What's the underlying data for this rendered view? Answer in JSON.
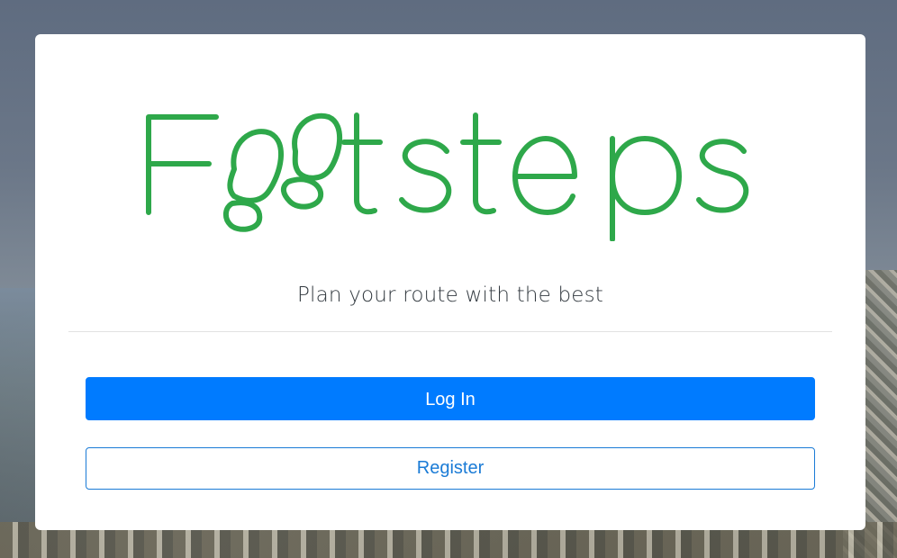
{
  "brand": {
    "logo_text": "Footsteps",
    "logo_color": "#2ea84a"
  },
  "tagline": "Plan your route with the best",
  "buttons": {
    "login_label": "Log In",
    "register_label": "Register"
  },
  "colors": {
    "primary": "#007bff",
    "outline": "#1a7bd6"
  }
}
